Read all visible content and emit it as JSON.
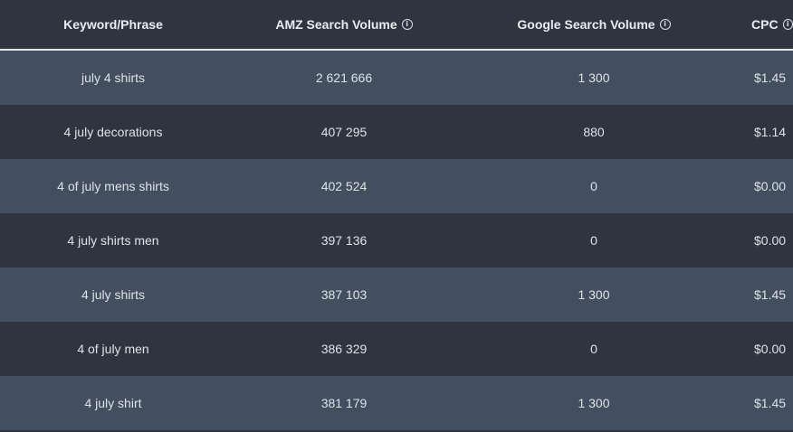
{
  "table": {
    "headers": {
      "keyword": "Keyword/Phrase",
      "amz": "AMZ Search Volume",
      "google": "Google Search Volume",
      "cpc": "CPC"
    },
    "info_glyph": "i",
    "rows": [
      {
        "keyword": "july 4 shirts",
        "amz": "2 621 666",
        "google": "1 300",
        "cpc": "$1.45"
      },
      {
        "keyword": "4 july decorations",
        "amz": "407 295",
        "google": "880",
        "cpc": "$1.14"
      },
      {
        "keyword": "4 of july mens shirts",
        "amz": "402 524",
        "google": "0",
        "cpc": "$0.00"
      },
      {
        "keyword": "4 july shirts men",
        "amz": "397 136",
        "google": "0",
        "cpc": "$0.00"
      },
      {
        "keyword": "4 july shirts",
        "amz": "387 103",
        "google": "1 300",
        "cpc": "$1.45"
      },
      {
        "keyword": "4 of july men",
        "amz": "386 329",
        "google": "0",
        "cpc": "$0.00"
      },
      {
        "keyword": "4 july shirt",
        "amz": "381 179",
        "google": "1 300",
        "cpc": "$1.45"
      }
    ]
  },
  "colors": {
    "background": "#2e3440",
    "row_alt": "#434e5e",
    "header_rule": "#e6e9ee",
    "text": "#dfe3e8"
  },
  "icons": {
    "info": "info-icon"
  }
}
